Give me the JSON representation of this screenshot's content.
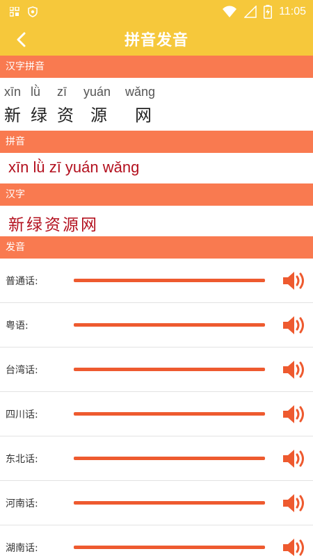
{
  "status": {
    "time": "11:05"
  },
  "appbar": {
    "title": "拼音发音"
  },
  "sections": {
    "ruby": "汉字拼音",
    "pinyin": "拼音",
    "hanzi": "汉字",
    "audio": "发音"
  },
  "ruby": {
    "pinyin": [
      "xīn",
      "lǜ",
      "zī",
      "yuán",
      "wǎng"
    ],
    "hanzi": [
      "新",
      "绿",
      "资",
      "源",
      "网"
    ]
  },
  "pinyin_line": "xīn lǜ zī yuán wǎng",
  "hanzi_line": "新绿资源网",
  "dialects": [
    {
      "label": "普通话:"
    },
    {
      "label": "粤语:"
    },
    {
      "label": "台湾话:"
    },
    {
      "label": "四川话:"
    },
    {
      "label": "东北话:"
    },
    {
      "label": "河南话:"
    },
    {
      "label": "湖南话:"
    }
  ],
  "colors": {
    "appbar": "#f6c83b",
    "section": "#f97a50",
    "accent": "#ee5a2f",
    "text_red": "#b3101e"
  },
  "icons": {
    "back": "chevron-left-icon",
    "speaker": "speaker-icon"
  }
}
